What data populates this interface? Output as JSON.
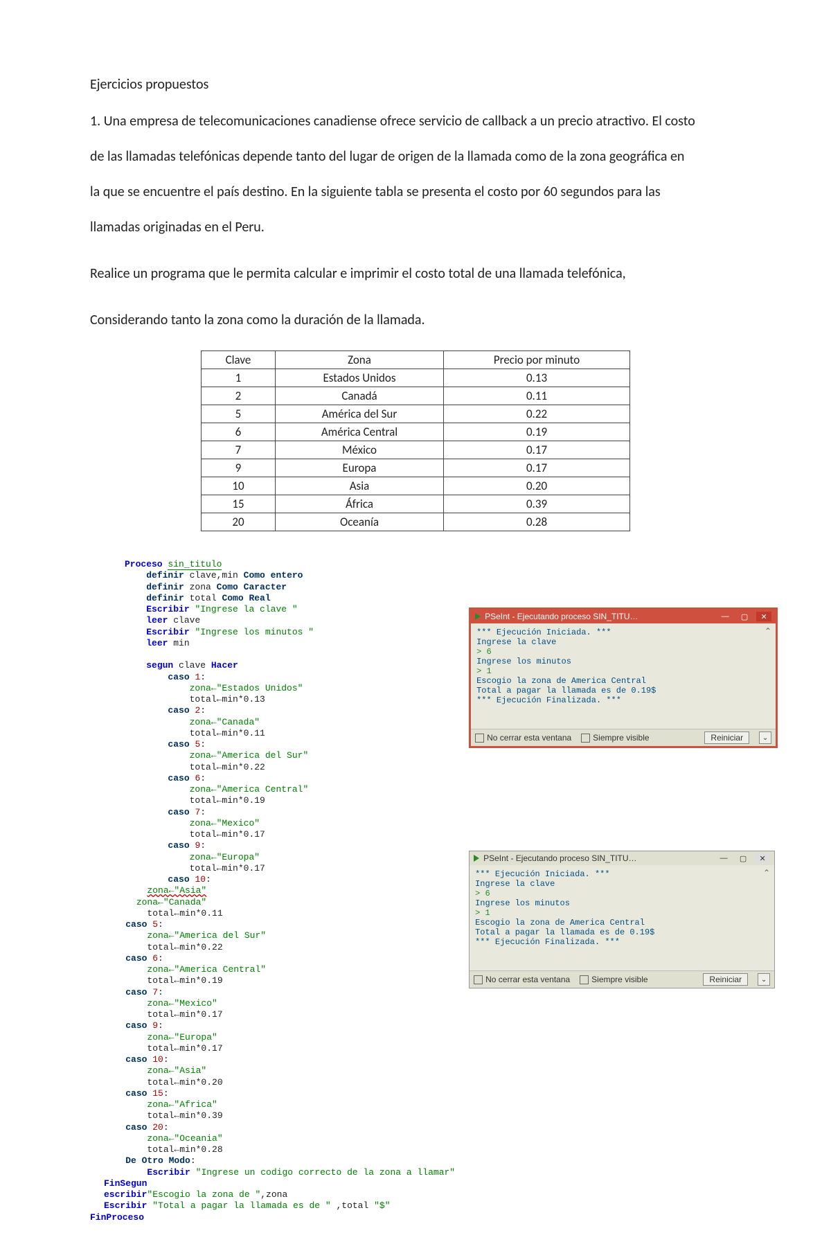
{
  "heading": "Ejercicios propuestos",
  "p1": "1. Una empresa de telecomunicaciones canadiense ofrece servicio de callback a un precio atractivo. El costo",
  "p2": "de las llamadas telefónicas depende tanto del lugar de origen de la llamada como de la zona geográfica en",
  "p3": "la que se encuentre el país destino. En la siguiente tabla se presenta el costo por 60 segundos para las",
  "p4": "llamadas originadas en el Peru.",
  "p5": "Realice un programa que le permita calcular e imprimir el costo total de una llamada telefónica,",
  "p6": "Considerando tanto la zona como la duración de la llamada.",
  "table": {
    "headers": [
      "Clave",
      "Zona",
      "Precio por minuto"
    ],
    "rows": [
      [
        "1",
        "Estados Unidos",
        "0.13"
      ],
      [
        "2",
        "Canadá",
        "0.11"
      ],
      [
        "5",
        "América del Sur",
        "0.22"
      ],
      [
        "6",
        "América Central",
        "0.19"
      ],
      [
        "7",
        "México",
        "0.17"
      ],
      [
        "9",
        "Europa",
        "0.17"
      ],
      [
        "10",
        "Asia",
        "0.20"
      ],
      [
        "15",
        "África",
        "0.39"
      ],
      [
        "20",
        "Oceanía",
        "0.28"
      ]
    ]
  },
  "code": {
    "proc_kw": "Proceso ",
    "proc_name": "sin_titulo",
    "def1a": "definir",
    "def1b": " clave,min ",
    "def1c": "Como entero",
    "def2a": "definir",
    "def2b": " zona ",
    "def2c": "Como Caracter",
    "def3a": "definir",
    "def3b": " total ",
    "def3c": "Como Real",
    "esc1a": "Escribir ",
    "esc1b": "\"Ingrese la clave \"",
    "leer1a": "leer",
    "leer1b": " clave",
    "esc2a": "Escribir ",
    "esc2b": "\"Ingrese los minutos \"",
    "leer2a": "leer",
    "leer2b": " min",
    "seg_a": "segun",
    "seg_b": " clave ",
    "seg_c": "Hacer",
    "case1_kw": "caso ",
    "case1_n": "1",
    "case1_c": ":",
    "case1_z": "zona←\"Estados Unidos\"",
    "case1_t": "total←min*0.13",
    "case2_kw": "caso ",
    "case2_n": "2",
    "case2_c": ":",
    "case2_z": "zona←\"Canada\"",
    "case2_t": "total←min*0.11",
    "case5_kw": "caso ",
    "case5_n": "5",
    "case5_c": ":",
    "case5_z": "zona←\"America del Sur\"",
    "case5_t": "total←min*0.22",
    "case6_kw": "caso ",
    "case6_n": "6",
    "case6_c": ":",
    "case6_z": "zona←\"America Central\"",
    "case6_t": "total←min*0.19",
    "case7_kw": "caso ",
    "case7_n": "7",
    "case7_c": ":",
    "case7_z": "zona←\"Mexico\"",
    "case7_t": "total←min*0.17",
    "case9_kw": "caso ",
    "case9_n": "9",
    "case9_c": ":",
    "case9_z": "zona←\"Europa\"",
    "case9_t": "total←min*0.17",
    "case10_kw": "caso ",
    "case10_n": "10",
    "case10_c": ":",
    "case10_z": "zona←\"Asia\"",
    "glitch_line": "zona←\"Canada\"",
    "case10b_t": "total←min*0.11",
    "b5_kw": "caso ",
    "b5_n": "5",
    "b5_c": ":",
    "b5_z": "zona←\"America del Sur\"",
    "b5_t": "total←min*0.22",
    "b6_kw": "caso ",
    "b6_n": "6",
    "b6_c": ":",
    "b6_z": "zona←\"America Central\"",
    "b6_t": "total←min*0.19",
    "b7_kw": "caso ",
    "b7_n": "7",
    "b7_c": ":",
    "b7_z": "zona←\"Mexico\"",
    "b7_t": "total←min*0.17",
    "b9_kw": "caso ",
    "b9_n": "9",
    "b9_c": ":",
    "b9_z": "zona←\"Europa\"",
    "b9_t": "total←min*0.17",
    "b10_kw": "caso ",
    "b10_n": "10",
    "b10_c": ":",
    "b10_z": "zona←\"Asia\"",
    "b10_t": "total←min*0.20",
    "b15_kw": "caso ",
    "b15_n": "15",
    "b15_c": ":",
    "b15_z": "zona←\"Africa\"",
    "b15_t": "total←min*0.39",
    "b20_kw": "caso ",
    "b20_n": "20",
    "b20_c": ":",
    "b20_z": "zona←\"Oceania\"",
    "b20_t": "total←min*0.28",
    "otro_kw": "De Otro Modo",
    "otro_c": ":",
    "otro_esc_a": "Escribir ",
    "otro_esc_b": "\"Ingrese un codigo correcto de la zona a llamar\"",
    "finseg": "FinSegun",
    "escz_a": "escribir",
    "escz_b": "\"Escogio la zona de \"",
    "escz_c": ",zona",
    "esct_a": "Escribir ",
    "esct_b": "\"Total a pagar la llamada es de \"",
    "esct_c": " ,total ",
    "esct_d": "\"$\"",
    "finproc": "FinProceso"
  },
  "win1": {
    "title": "PSeInt - Ejecutando proceso SIN_TITU…",
    "min": "—",
    "max": "▢",
    "close": "✕",
    "l1": "*** Ejecución Iniciada. ***",
    "l2": "Ingrese la clave",
    "l3": "> 6",
    "l4": "Ingrese los minutos",
    "l5": "> 1",
    "l6": "Escogio la zona de America Central",
    "l7": "Total a pagar la llamada es de 0.19$",
    "l8": "*** Ejecución Finalizada. ***",
    "foot_chk1": "No cerrar esta ventana",
    "foot_chk2": "Siempre visible",
    "foot_btn": "Reiniciar",
    "foot_dd": "⌄",
    "arrow": "⌃"
  },
  "win2": {
    "title": "PSeInt - Ejecutando proceso SIN_TITU…",
    "min": "—",
    "max": "▢",
    "close": "✕",
    "l1": "*** Ejecución Iniciada. ***",
    "l2": "Ingrese la clave",
    "l3": "> 6",
    "l4": "Ingrese los minutos",
    "l5": "> 1",
    "l6": "Escogio la zona de America Central",
    "l7": "Total a pagar la llamada es de 0.19$",
    "l8": "*** Ejecución Finalizada. ***",
    "foot_chk1": "No cerrar esta ventana",
    "foot_chk2": "Siempre visible",
    "foot_btn": "Reiniciar",
    "foot_dd": "⌄",
    "arrow": "⌃"
  }
}
